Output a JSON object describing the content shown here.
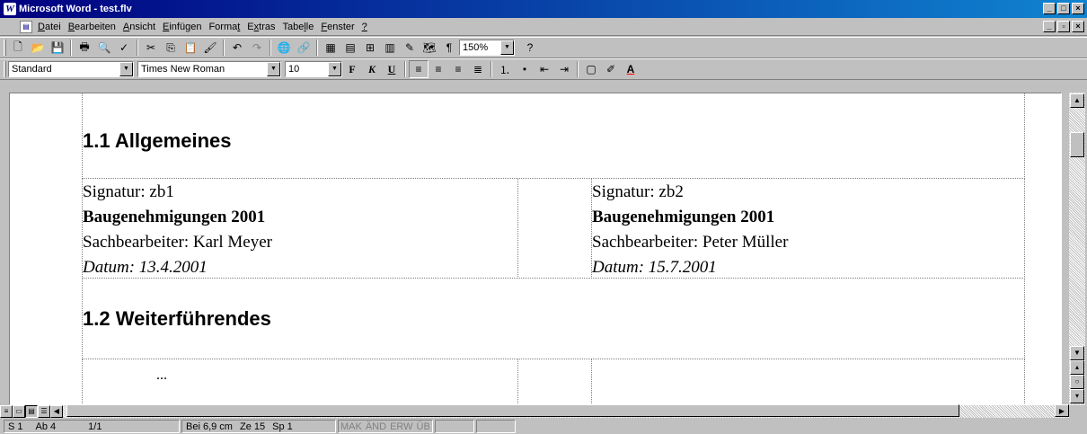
{
  "window": {
    "title": "Microsoft Word - test.flv",
    "app_icon": "W"
  },
  "menu": {
    "items": [
      {
        "pre": "",
        "u": "D",
        "post": "atei"
      },
      {
        "pre": "",
        "u": "B",
        "post": "earbeiten"
      },
      {
        "pre": "",
        "u": "A",
        "post": "nsicht"
      },
      {
        "pre": "",
        "u": "E",
        "post": "infügen"
      },
      {
        "pre": "Forma",
        "u": "t",
        "post": ""
      },
      {
        "pre": "E",
        "u": "x",
        "post": "tras"
      },
      {
        "pre": "Tabe",
        "u": "l",
        "post": "le"
      },
      {
        "pre": "",
        "u": "F",
        "post": "enster"
      },
      {
        "pre": "",
        "u": "?",
        "post": ""
      }
    ]
  },
  "toolbar": {
    "zoom": "150%",
    "style": "Standard",
    "font": "Times New Roman",
    "size": "10",
    "bold": "F",
    "italic": "K",
    "underline": "U"
  },
  "document": {
    "heading1": "1.1 Allgemeines",
    "heading2": "1.2 Weiterführendes",
    "entries": [
      {
        "signatur": "Signatur: zb1",
        "title": "Baugenehmigungen 2001",
        "person": "Sachbearbeiter: Karl Meyer",
        "date": "Datum: 13.4.2001"
      },
      {
        "signatur": "Signatur: zb2",
        "title": "Baugenehmigungen 2001",
        "person": "Sachbearbeiter: Peter Müller",
        "date": "Datum: 15.7.2001"
      }
    ],
    "ellipsis": "..."
  },
  "status": {
    "page": "S 1",
    "section": "Ab 4",
    "pages": "1/1",
    "position": "Bei 6,9 cm",
    "line": "Ze 15",
    "column": "Sp 1",
    "mak": "MAK",
    "and": "ÄND",
    "erw": "ERW",
    "ub": "ÜB"
  }
}
